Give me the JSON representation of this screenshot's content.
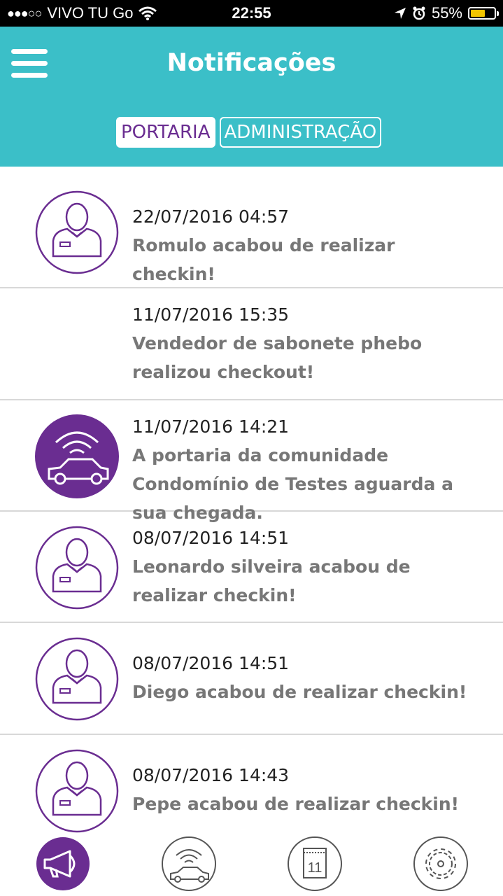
{
  "status_bar": {
    "signal": "●●●○○",
    "carrier": "VIVO TU Go",
    "time": "22:55",
    "battery": "55%",
    "battery_color": "#f2c500"
  },
  "header": {
    "title": "Notificações",
    "tabs": [
      {
        "label": "PORTARIA",
        "active": true
      },
      {
        "label": "ADMINISTRAÇÃO",
        "active": false
      }
    ]
  },
  "notifications": [
    {
      "date": "22/07/2016 04:57",
      "message": "Romulo acabou de realizar checkin!",
      "icon": "person-icon"
    },
    {
      "date": "11/07/2016 15:35",
      "message": "Vendedor de sabonete phebo realizou checkout!",
      "icon": "none"
    },
    {
      "date": "11/07/2016 14:21",
      "message": "A portaria da comunidade Condomínio de Testes aguarda a sua chegada.",
      "icon": "car-signal-icon"
    },
    {
      "date": "08/07/2016 14:51",
      "message": "Leonardo silveira acabou de realizar checkin!",
      "icon": "person-icon"
    },
    {
      "date": "08/07/2016 14:51",
      "message": "Diego acabou de realizar checkin!",
      "icon": "person-icon"
    },
    {
      "date": "08/07/2016 14:43",
      "message": "Pepe acabou de realizar checkin!",
      "icon": "person-icon"
    }
  ],
  "bottom_nav": [
    {
      "icon": "megaphone-icon",
      "active": true
    },
    {
      "icon": "car-signal-icon",
      "active": false
    },
    {
      "icon": "calendar-icon",
      "label": "11",
      "active": false
    },
    {
      "icon": "gear-icon",
      "active": false
    }
  ],
  "colors": {
    "header": "#3bbfc8",
    "accent": "#6a2d91"
  }
}
